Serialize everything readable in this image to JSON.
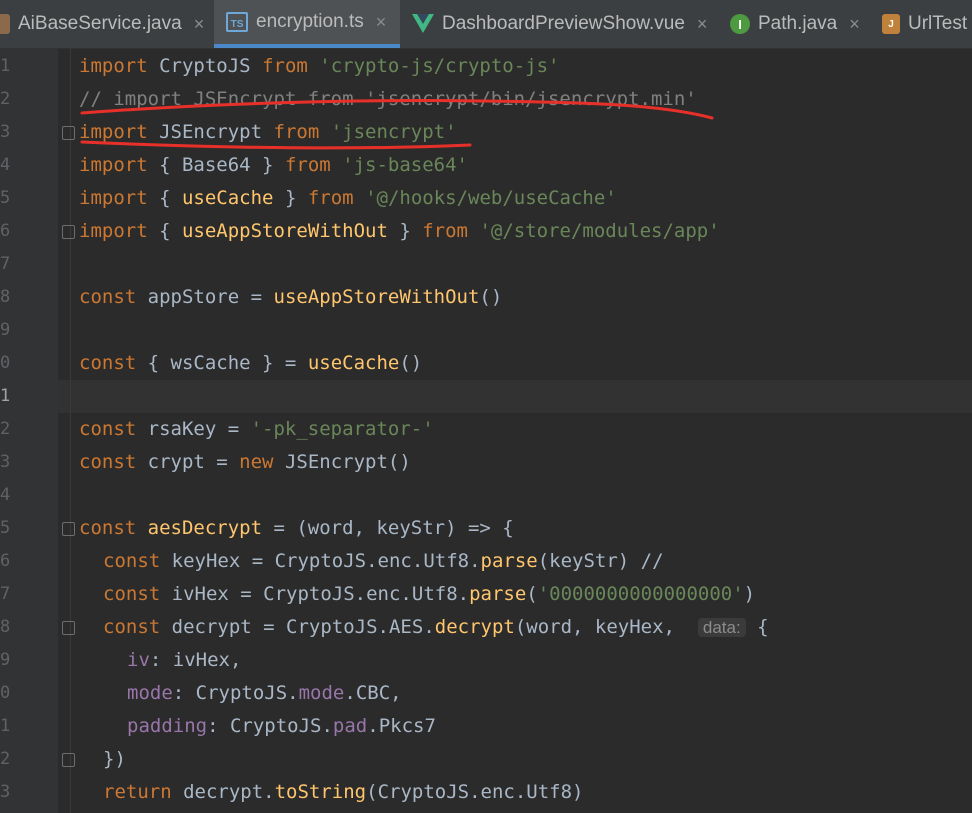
{
  "tabs": [
    {
      "label": "AiBaseService.java",
      "icon": "java-file-icon"
    },
    {
      "label": "encryption.ts",
      "icon": "typescript-file-icon",
      "active": true
    },
    {
      "label": "DashboardPreviewShow.vue",
      "icon": "vue-file-icon"
    },
    {
      "label": "Path.java",
      "icon": "interface-file-icon"
    },
    {
      "label": "UrlTest",
      "icon": "java-test-file-icon"
    }
  ],
  "close_glyph": "×",
  "line_numbers": [
    "1",
    "2",
    "3",
    "4",
    "5",
    "6",
    "7",
    "8",
    "9",
    "0",
    "1",
    "2",
    "3",
    "4",
    "5",
    "6",
    "7",
    "8",
    "9",
    "0",
    "1",
    "2",
    "3"
  ],
  "code": {
    "l1": [
      "import",
      "CryptoJS",
      "from",
      "'crypto-js/crypto-js'"
    ],
    "l2": "// import JSEncrypt from 'jsencrypt/bin/jsencrypt.min'",
    "l3": [
      "import",
      "JSEncrypt",
      "from",
      "'jsencrypt'"
    ],
    "l4": [
      "import",
      "{ Base64 }",
      "from",
      "'js-base64'"
    ],
    "l5": [
      "import",
      "{ ",
      "useCache",
      " }",
      "from",
      "'@/hooks/web/useCache'"
    ],
    "l6": [
      "import",
      "{ ",
      "useAppStoreWithOut",
      " }",
      "from",
      "'@/store/modules/app'"
    ],
    "l8": [
      "const",
      "appStore = ",
      "useAppStoreWithOut",
      "()"
    ],
    "l10": [
      "const",
      "{ wsCache } = ",
      "useCache",
      "()"
    ],
    "l12": [
      "const",
      "rsaKey = ",
      "'-pk_separator-'"
    ],
    "l13": [
      "const",
      "crypt = ",
      "new",
      "JSEncrypt()"
    ],
    "l15": [
      "const",
      "aesDecrypt",
      " = (word, keyStr) => {"
    ],
    "l16": [
      "const",
      "keyHex = CryptoJS.enc.Utf8.",
      "parse",
      "(keyStr) //"
    ],
    "l17": [
      "const",
      "ivHex = CryptoJS.enc.Utf8.",
      "parse",
      "(",
      "'0000000000000000'",
      ")"
    ],
    "l18": [
      "const",
      "decrypt = CryptoJS.AES.",
      "decrypt",
      "(word, keyHex,",
      "data:",
      "{"
    ],
    "l19": [
      "iv",
      ": ivHex,"
    ],
    "l20": [
      "mode",
      ": CryptoJS.",
      "mode",
      ".CBC,"
    ],
    "l21": [
      "padding",
      ": CryptoJS.",
      "pad",
      ".Pkcs7"
    ],
    "l22": "})",
    "l23": [
      "return",
      "decrypt.",
      "toString",
      "(CryptoJS.enc.Utf8)"
    ]
  },
  "colors": {
    "annotation": "#e8302a",
    "keyword": "#cc7832",
    "string": "#6a8759",
    "function": "#ffc66d"
  }
}
